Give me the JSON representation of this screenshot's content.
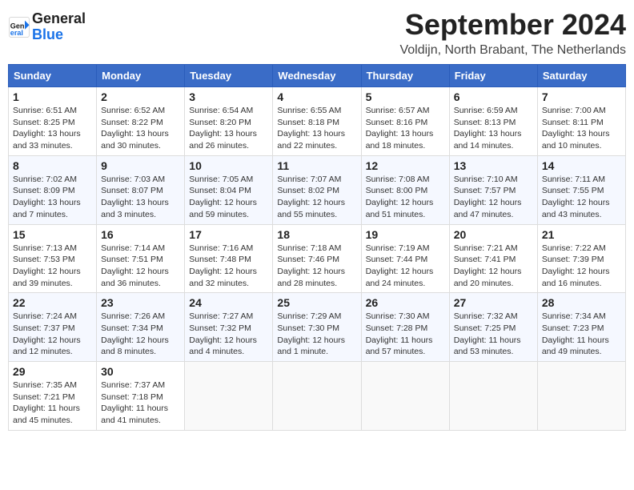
{
  "header": {
    "logo_text_1": "General",
    "logo_text_2": "Blue",
    "month": "September 2024",
    "location": "Voldijn, North Brabant, The Netherlands"
  },
  "weekdays": [
    "Sunday",
    "Monday",
    "Tuesday",
    "Wednesday",
    "Thursday",
    "Friday",
    "Saturday"
  ],
  "weeks": [
    [
      {
        "day": "1",
        "info": "Sunrise: 6:51 AM\nSunset: 8:25 PM\nDaylight: 13 hours\nand 33 minutes."
      },
      {
        "day": "2",
        "info": "Sunrise: 6:52 AM\nSunset: 8:22 PM\nDaylight: 13 hours\nand 30 minutes."
      },
      {
        "day": "3",
        "info": "Sunrise: 6:54 AM\nSunset: 8:20 PM\nDaylight: 13 hours\nand 26 minutes."
      },
      {
        "day": "4",
        "info": "Sunrise: 6:55 AM\nSunset: 8:18 PM\nDaylight: 13 hours\nand 22 minutes."
      },
      {
        "day": "5",
        "info": "Sunrise: 6:57 AM\nSunset: 8:16 PM\nDaylight: 13 hours\nand 18 minutes."
      },
      {
        "day": "6",
        "info": "Sunrise: 6:59 AM\nSunset: 8:13 PM\nDaylight: 13 hours\nand 14 minutes."
      },
      {
        "day": "7",
        "info": "Sunrise: 7:00 AM\nSunset: 8:11 PM\nDaylight: 13 hours\nand 10 minutes."
      }
    ],
    [
      {
        "day": "8",
        "info": "Sunrise: 7:02 AM\nSunset: 8:09 PM\nDaylight: 13 hours\nand 7 minutes."
      },
      {
        "day": "9",
        "info": "Sunrise: 7:03 AM\nSunset: 8:07 PM\nDaylight: 13 hours\nand 3 minutes."
      },
      {
        "day": "10",
        "info": "Sunrise: 7:05 AM\nSunset: 8:04 PM\nDaylight: 12 hours\nand 59 minutes."
      },
      {
        "day": "11",
        "info": "Sunrise: 7:07 AM\nSunset: 8:02 PM\nDaylight: 12 hours\nand 55 minutes."
      },
      {
        "day": "12",
        "info": "Sunrise: 7:08 AM\nSunset: 8:00 PM\nDaylight: 12 hours\nand 51 minutes."
      },
      {
        "day": "13",
        "info": "Sunrise: 7:10 AM\nSunset: 7:57 PM\nDaylight: 12 hours\nand 47 minutes."
      },
      {
        "day": "14",
        "info": "Sunrise: 7:11 AM\nSunset: 7:55 PM\nDaylight: 12 hours\nand 43 minutes."
      }
    ],
    [
      {
        "day": "15",
        "info": "Sunrise: 7:13 AM\nSunset: 7:53 PM\nDaylight: 12 hours\nand 39 minutes."
      },
      {
        "day": "16",
        "info": "Sunrise: 7:14 AM\nSunset: 7:51 PM\nDaylight: 12 hours\nand 36 minutes."
      },
      {
        "day": "17",
        "info": "Sunrise: 7:16 AM\nSunset: 7:48 PM\nDaylight: 12 hours\nand 32 minutes."
      },
      {
        "day": "18",
        "info": "Sunrise: 7:18 AM\nSunset: 7:46 PM\nDaylight: 12 hours\nand 28 minutes."
      },
      {
        "day": "19",
        "info": "Sunrise: 7:19 AM\nSunset: 7:44 PM\nDaylight: 12 hours\nand 24 minutes."
      },
      {
        "day": "20",
        "info": "Sunrise: 7:21 AM\nSunset: 7:41 PM\nDaylight: 12 hours\nand 20 minutes."
      },
      {
        "day": "21",
        "info": "Sunrise: 7:22 AM\nSunset: 7:39 PM\nDaylight: 12 hours\nand 16 minutes."
      }
    ],
    [
      {
        "day": "22",
        "info": "Sunrise: 7:24 AM\nSunset: 7:37 PM\nDaylight: 12 hours\nand 12 minutes."
      },
      {
        "day": "23",
        "info": "Sunrise: 7:26 AM\nSunset: 7:34 PM\nDaylight: 12 hours\nand 8 minutes."
      },
      {
        "day": "24",
        "info": "Sunrise: 7:27 AM\nSunset: 7:32 PM\nDaylight: 12 hours\nand 4 minutes."
      },
      {
        "day": "25",
        "info": "Sunrise: 7:29 AM\nSunset: 7:30 PM\nDaylight: 12 hours\nand 1 minute."
      },
      {
        "day": "26",
        "info": "Sunrise: 7:30 AM\nSunset: 7:28 PM\nDaylight: 11 hours\nand 57 minutes."
      },
      {
        "day": "27",
        "info": "Sunrise: 7:32 AM\nSunset: 7:25 PM\nDaylight: 11 hours\nand 53 minutes."
      },
      {
        "day": "28",
        "info": "Sunrise: 7:34 AM\nSunset: 7:23 PM\nDaylight: 11 hours\nand 49 minutes."
      }
    ],
    [
      {
        "day": "29",
        "info": "Sunrise: 7:35 AM\nSunset: 7:21 PM\nDaylight: 11 hours\nand 45 minutes."
      },
      {
        "day": "30",
        "info": "Sunrise: 7:37 AM\nSunset: 7:18 PM\nDaylight: 11 hours\nand 41 minutes."
      },
      {
        "day": "",
        "info": ""
      },
      {
        "day": "",
        "info": ""
      },
      {
        "day": "",
        "info": ""
      },
      {
        "day": "",
        "info": ""
      },
      {
        "day": "",
        "info": ""
      }
    ]
  ]
}
